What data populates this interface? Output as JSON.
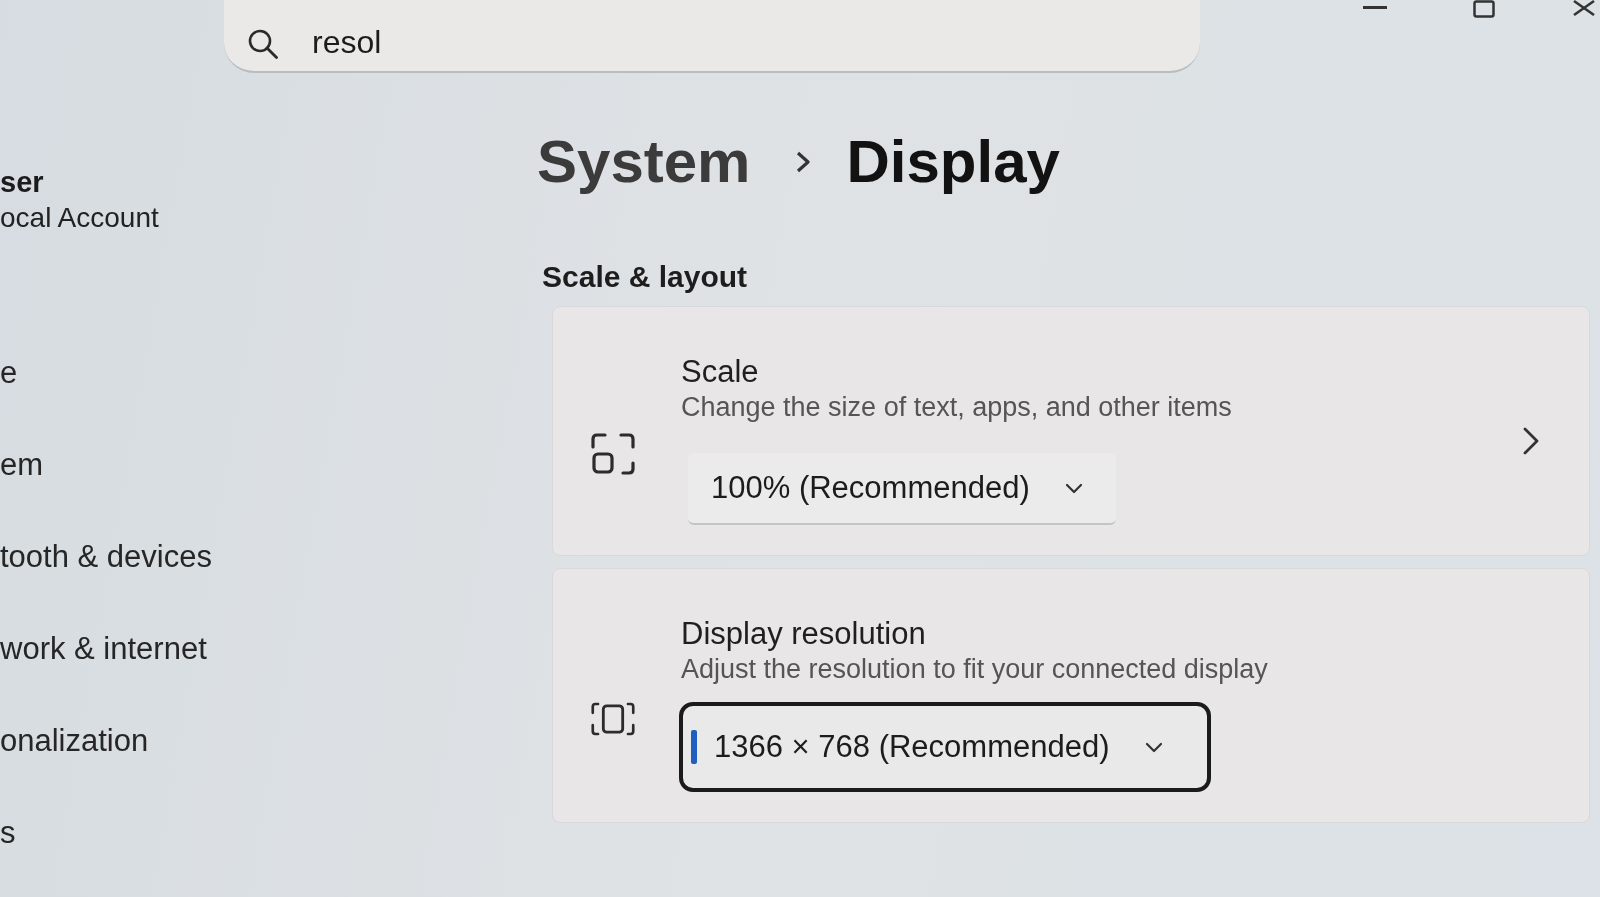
{
  "search": {
    "value": "resol"
  },
  "account": {
    "name": "ser",
    "type": "ocal Account"
  },
  "sidebar": {
    "items": [
      {
        "label": "e"
      },
      {
        "label": "em"
      },
      {
        "label": "tooth & devices"
      },
      {
        "label": "work & internet"
      },
      {
        "label": "onalization"
      },
      {
        "label": "s"
      }
    ]
  },
  "breadcrumb": [
    {
      "label": "System",
      "current": false
    },
    {
      "label": "Display",
      "current": true
    }
  ],
  "section": {
    "title": "Scale & layout",
    "settings": [
      {
        "kind": "dropdown",
        "title": "Scale",
        "description": "Change the size of text, apps, and other items",
        "value": "100% (Recommended)",
        "focused": false,
        "expandable": true
      },
      {
        "kind": "dropdown",
        "title": "Display resolution",
        "description": "Adjust the resolution to fit your connected display",
        "value": "1366 × 768 (Recommended)",
        "focused": true,
        "expandable": false
      }
    ]
  }
}
